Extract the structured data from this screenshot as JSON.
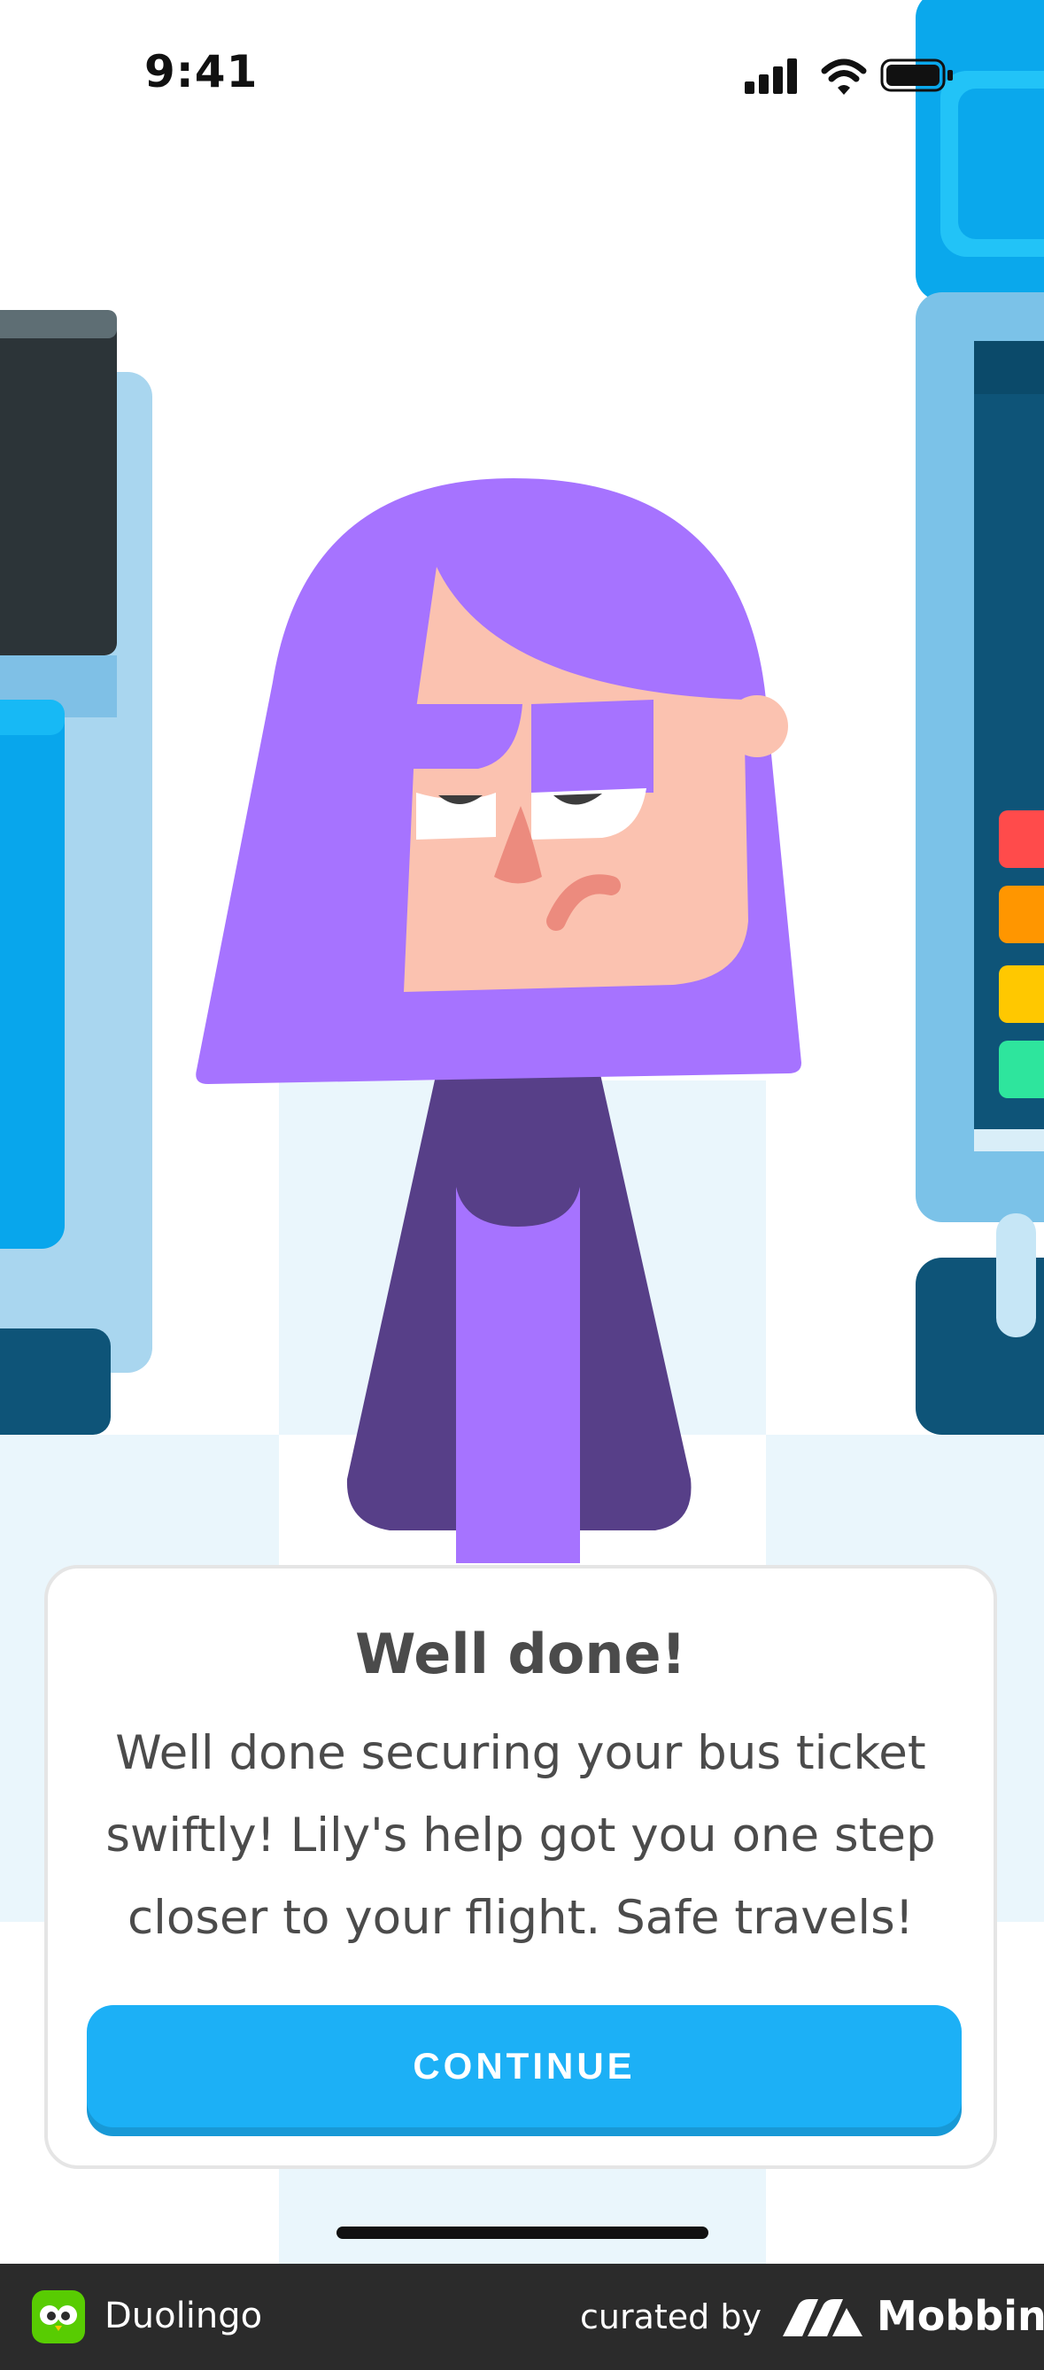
{
  "status_bar": {
    "time": "9:41"
  },
  "dialog": {
    "title": "Well done!",
    "message": "Well done securing your bus ticket swiftly! Lily's help got you one step closer to your flight. Safe travels!",
    "continue_label": "CONTINUE"
  },
  "footer": {
    "app_name": "Duolingo",
    "curated_label": "curated by",
    "brand": "Mobbin"
  },
  "colors": {
    "accent": "#1cb0f6",
    "accent_shadow": "#1899d6",
    "hair": "#a673ff",
    "skin": "#fbc2b0",
    "footer_bg": "#2b2b2b"
  }
}
